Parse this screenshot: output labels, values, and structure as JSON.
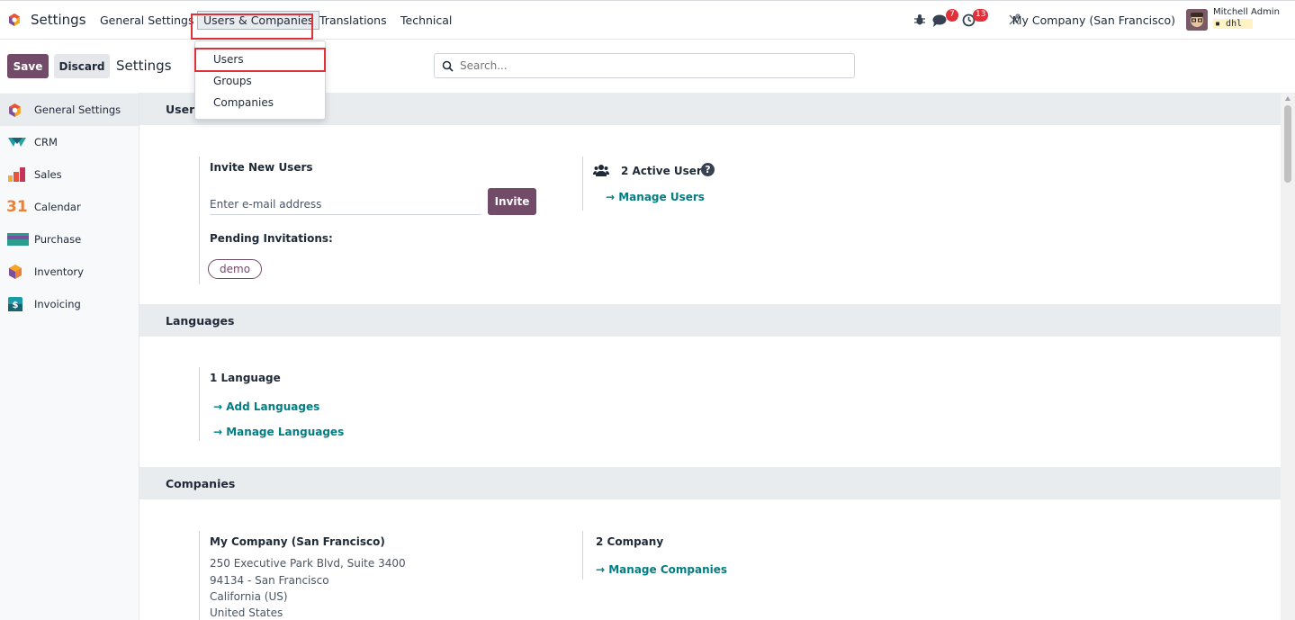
{
  "navbar": {
    "app_name": "Settings",
    "menus": [
      "General Settings",
      "Users & Companies",
      "Translations",
      "Technical"
    ],
    "active_menu": "Users & Companies",
    "messages_badge": "7",
    "activities_badge": "13",
    "company": "My Company (San Francisco)",
    "user_name": "Mitchell Admin",
    "database": "dhl"
  },
  "dropdown": {
    "items": [
      "Users",
      "Groups",
      "Companies"
    ],
    "highlighted": "Users"
  },
  "control_panel": {
    "save_label": "Save",
    "discard_label": "Discard",
    "breadcrumb": "Settings",
    "search_placeholder": "Search..."
  },
  "sidebar": {
    "items": [
      {
        "label": "General Settings",
        "icon": "odoo-logo-icon",
        "active": true
      },
      {
        "label": "CRM",
        "icon": "crm-icon"
      },
      {
        "label": "Sales",
        "icon": "sales-chart-icon"
      },
      {
        "label": "Calendar",
        "icon": "calendar-31-icon"
      },
      {
        "label": "Purchase",
        "icon": "purchase-card-icon"
      },
      {
        "label": "Inventory",
        "icon": "inventory-box-icon"
      },
      {
        "label": "Invoicing",
        "icon": "invoicing-dollar-icon"
      }
    ]
  },
  "users_section": {
    "title": "Users",
    "invite_title": "Invite New Users",
    "email_placeholder": "Enter e-mail address",
    "invite_button": "Invite",
    "pending_label": "Pending Invitations:",
    "pending_tag": "demo",
    "active_users": "2 Active User",
    "manage_users": "Manage Users"
  },
  "languages_section": {
    "title": "Languages",
    "count": "1 Language",
    "add_link": "Add Languages",
    "manage_link": "Manage Languages"
  },
  "companies_section": {
    "title": "Companies",
    "company_name": "My Company (San Francisco)",
    "address_lines": [
      "250 Executive Park Blvd, Suite 3400",
      "94134 - San Francisco",
      "California (US)",
      "United States"
    ],
    "count": "2 Company",
    "manage_link": "Manage Companies"
  },
  "colors": {
    "primary": "#714b67",
    "link": "#017e84",
    "highlight_box": "#e0313a"
  }
}
